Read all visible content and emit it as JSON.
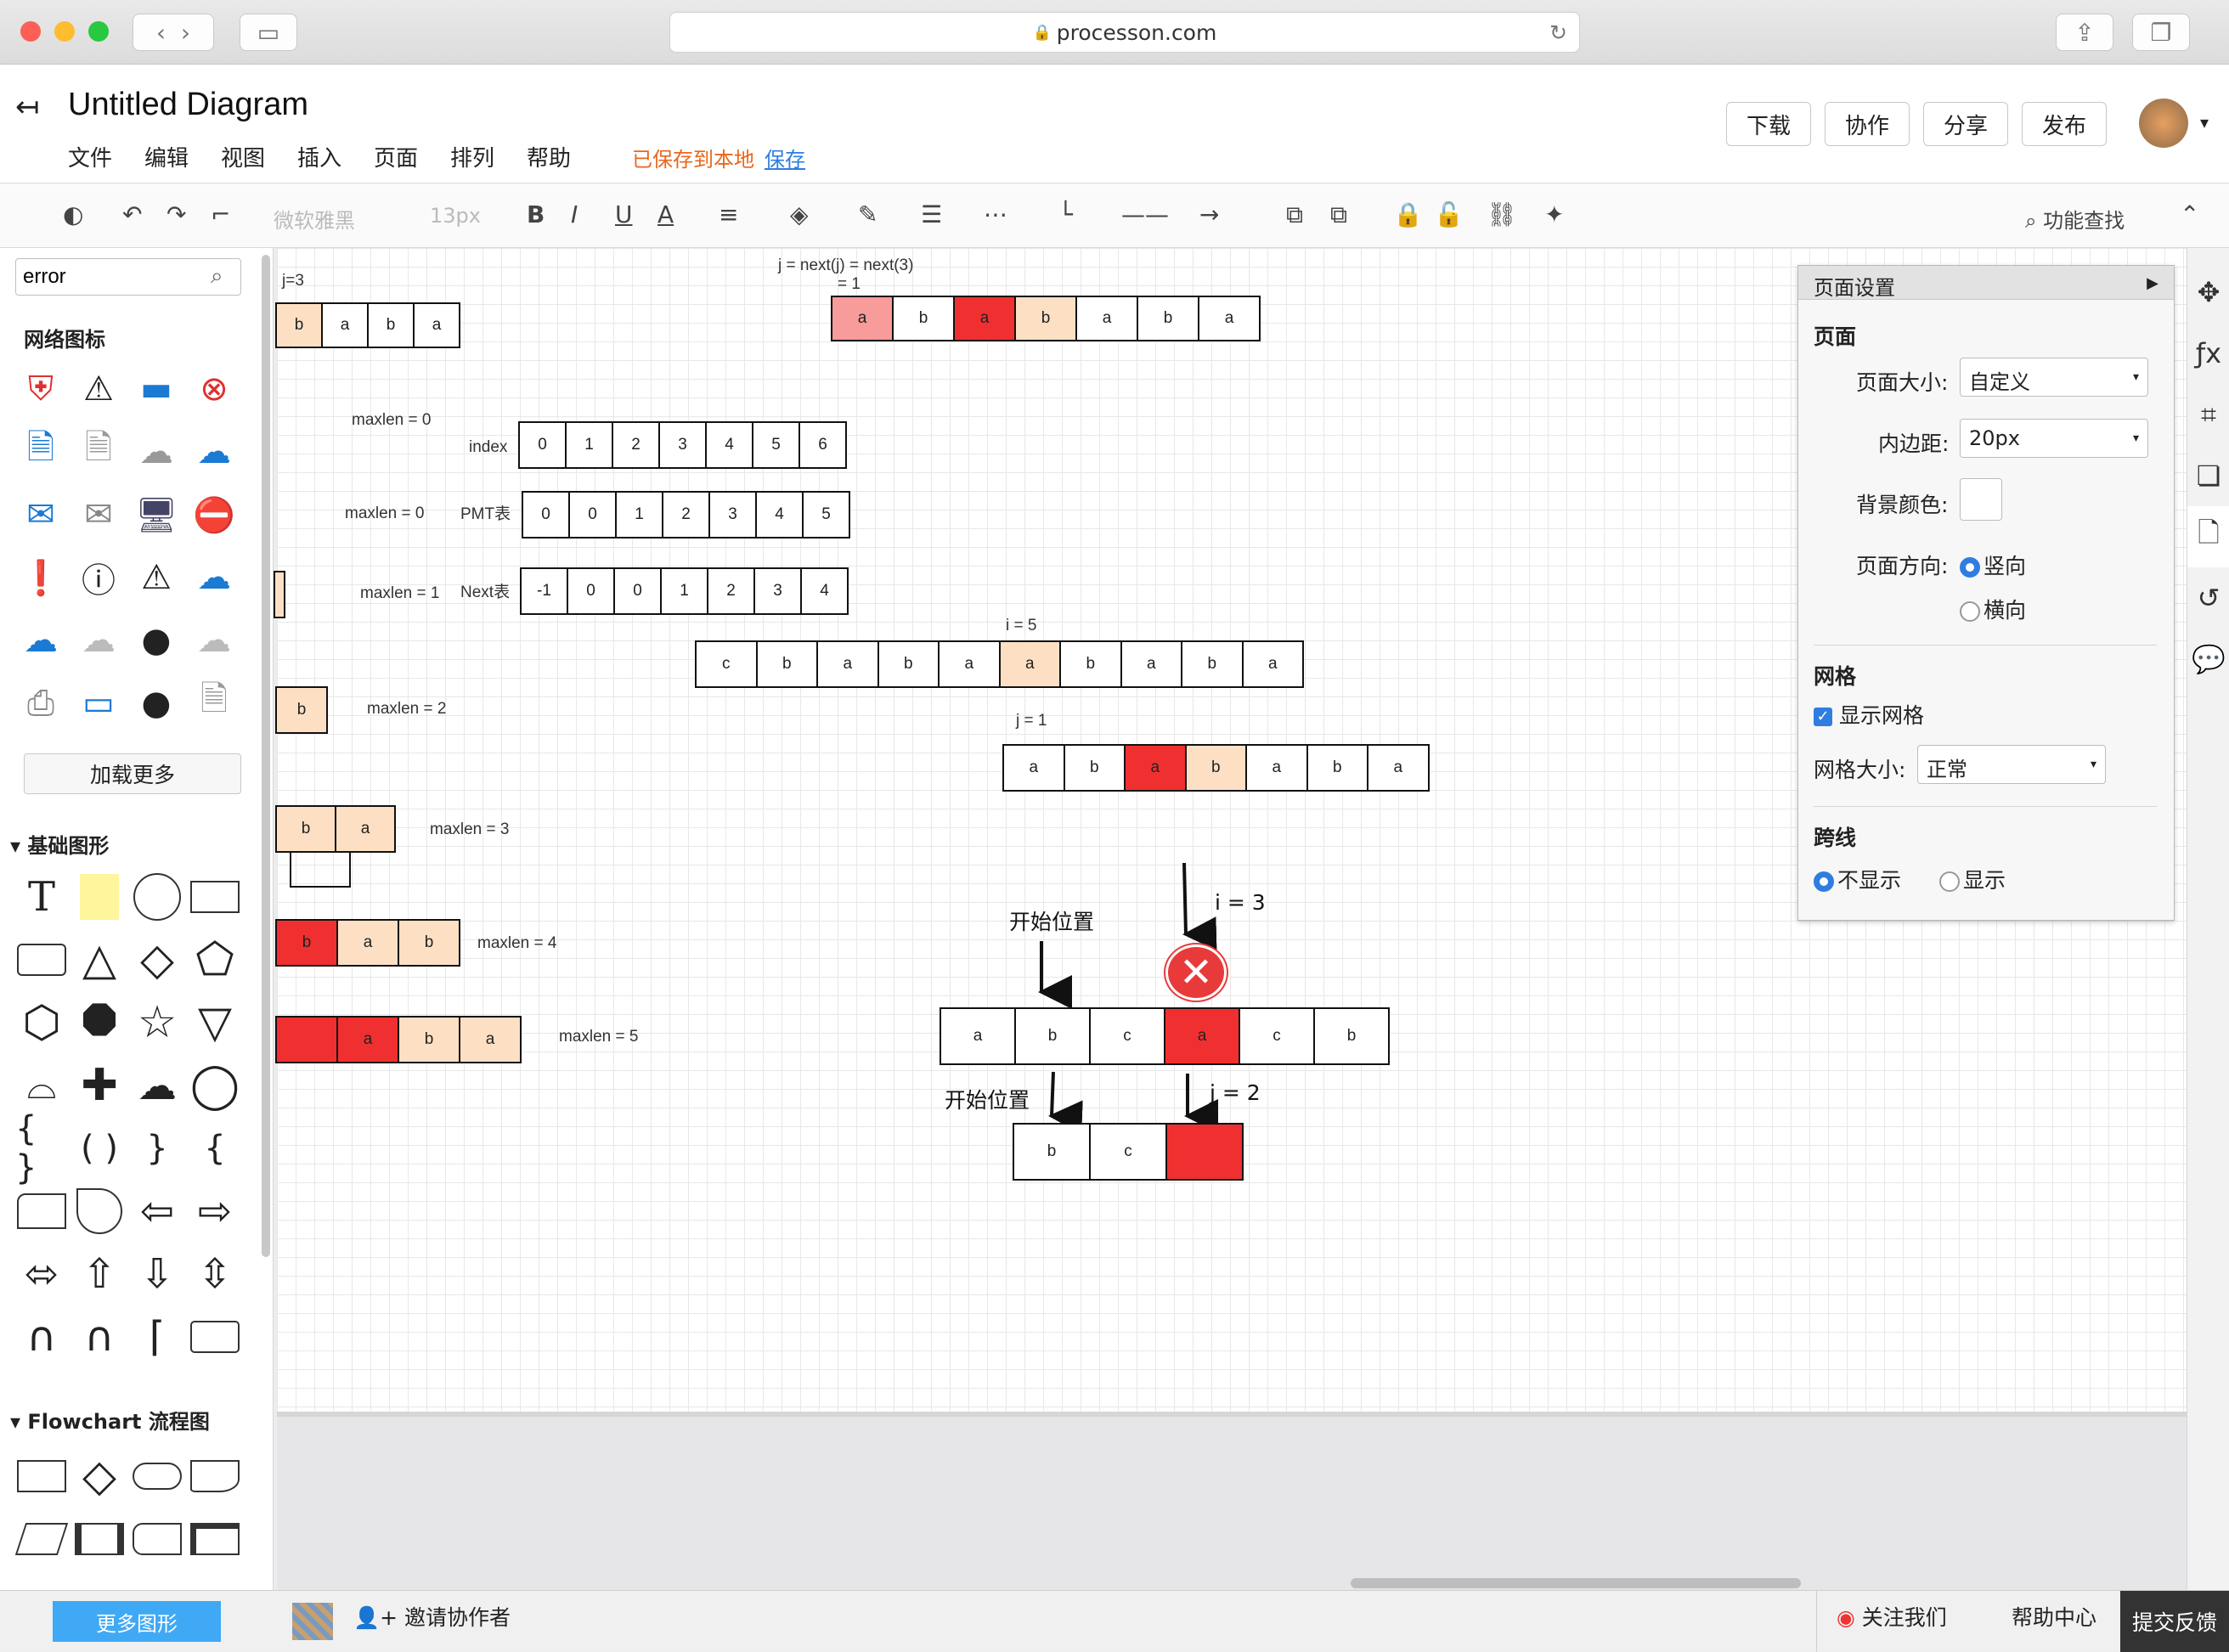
{
  "browser": {
    "url": "processon.com"
  },
  "app": {
    "title": "Untitled Diagram",
    "menu": [
      "文件",
      "编辑",
      "视图",
      "插入",
      "页面",
      "排列",
      "帮助"
    ],
    "saved_status": "已保存到本地",
    "save_link": "保存",
    "buttons": {
      "download": "下载",
      "collab": "协作",
      "share": "分享",
      "publish": "发布"
    }
  },
  "toolbar": {
    "font": "微软雅黑",
    "size": "13px",
    "find": "功能查找"
  },
  "sidebar": {
    "search_value": "error",
    "network_title": "网络图标",
    "load_more": "加载更多",
    "basic_title": "基础图形",
    "flow_title": "Flowchart 流程图",
    "more_shapes": "更多图形"
  },
  "canvas": {
    "labels": {
      "j3": "j=3",
      "jnext": "j = next(j) = next(3)",
      "jnext2": "= 1",
      "maxlen0a": "maxlen = 0",
      "index": "index",
      "maxlen0b": "maxlen = 0",
      "pmt": "PMT表",
      "maxlen1": "maxlen = 1",
      "next": "Next表",
      "i5": "i = 5",
      "maxlen2": "maxlen = 2",
      "j1": "j = 1",
      "maxlen3": "maxlen = 3",
      "maxlen4": "maxlen = 4",
      "maxlen5": "maxlen = 5",
      "start1": "开始位置",
      "i3": "i = 3",
      "start2": "开始位置",
      "j2": "j = 2"
    },
    "index_row": [
      "0",
      "1",
      "2",
      "3",
      "4",
      "5",
      "6"
    ],
    "pmt_row": [
      "0",
      "0",
      "1",
      "2",
      "3",
      "4",
      "5"
    ],
    "next_row": [
      "-1",
      "0",
      "0",
      "1",
      "2",
      "3",
      "4"
    ],
    "top_row": [
      "a",
      "b",
      "a",
      "b",
      "a",
      "b",
      "a"
    ],
    "left_top": [
      "b",
      "a",
      "b",
      "a"
    ],
    "main_row": [
      "c",
      "b",
      "a",
      "b",
      "a",
      "a",
      "b",
      "a",
      "b",
      "a"
    ],
    "j1_row": [
      "a",
      "b",
      "a",
      "b",
      "a",
      "b",
      "a"
    ],
    "row3": [
      "b",
      "a"
    ],
    "row4": [
      "b",
      "a",
      "b"
    ],
    "row5": [
      "",
      "a",
      "b",
      "a"
    ],
    "row_b": [
      "b"
    ],
    "abc_row": [
      "a",
      "b",
      "c",
      "a",
      "c",
      "b"
    ],
    "bc_row": [
      "b",
      "c",
      ""
    ]
  },
  "page_settings": {
    "title": "页面设置",
    "page": "页面",
    "size_label": "页面大小:",
    "size_value": "自定义",
    "padding_label": "内边距:",
    "padding_value": "20px",
    "bg_label": "背景颜色:",
    "orient_label": "页面方向:",
    "portrait": "竖向",
    "landscape": "横向",
    "grid": "网格",
    "show_grid": "显示网格",
    "grid_size_label": "网格大小:",
    "grid_size_value": "正常",
    "jump": "跨线",
    "hide": "不显示",
    "show": "显示"
  },
  "status": {
    "invite": "邀请协作者",
    "follow": "关注我们",
    "help": "帮助中心",
    "feedback": "提交反馈"
  },
  "colors": {
    "red": "#f03030",
    "pink": "#f79b9b",
    "peach": "#fde0c4",
    "accent": "#2f7de1"
  }
}
